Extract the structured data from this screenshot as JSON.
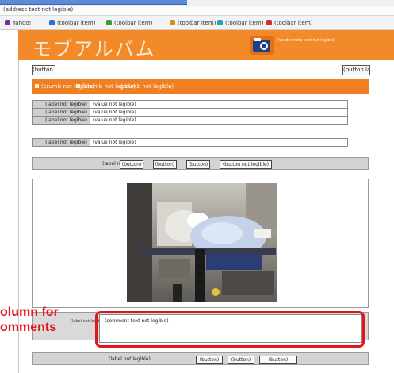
{
  "browser": {
    "address": "(address text not legible)",
    "toolbar_items": [
      "Yahoo!",
      "(toolbar item)",
      "(toolbar item)",
      "(toolbar item)",
      "(toolbar item)",
      "(toolbar item)"
    ]
  },
  "app": {
    "title": "モブアルバム",
    "header_note": "(header note text not legible)"
  },
  "nav": {
    "back_label": "(button label not legible)",
    "logout_label": "(button label not legible)"
  },
  "breadcrumb": {
    "items": [
      "(crumb not legible)",
      "(crumb not legible)",
      "(crumb not legible)"
    ]
  },
  "info_table": {
    "rows": [
      {
        "label": "(label not legible)",
        "value": "(value not legible)"
      },
      {
        "label": "(label not legible)",
        "value": "(value not legible)"
      },
      {
        "label": "(label not legible)",
        "value": "(value not legible)"
      }
    ]
  },
  "title_row": {
    "label": "(label not legible)",
    "value": "(value not legible)"
  },
  "actions": {
    "label": "(label not legible)",
    "buttons": [
      "(button)",
      "(button)",
      "(button)",
      "(button not legible)"
    ]
  },
  "comment": {
    "label": "(label not legible)",
    "value": "(comment text not legible)"
  },
  "bottom": {
    "label": "(label not legible)",
    "buttons": [
      "(button)",
      "(button)",
      "(button)"
    ]
  },
  "annotation": {
    "line1": "olumn for",
    "line2": "omments",
    "color": "#e3161b"
  },
  "colors": {
    "brand_orange": "#f28a2a",
    "breadcrumb_orange": "#ef7f22",
    "highlight_red": "#e3161b"
  }
}
